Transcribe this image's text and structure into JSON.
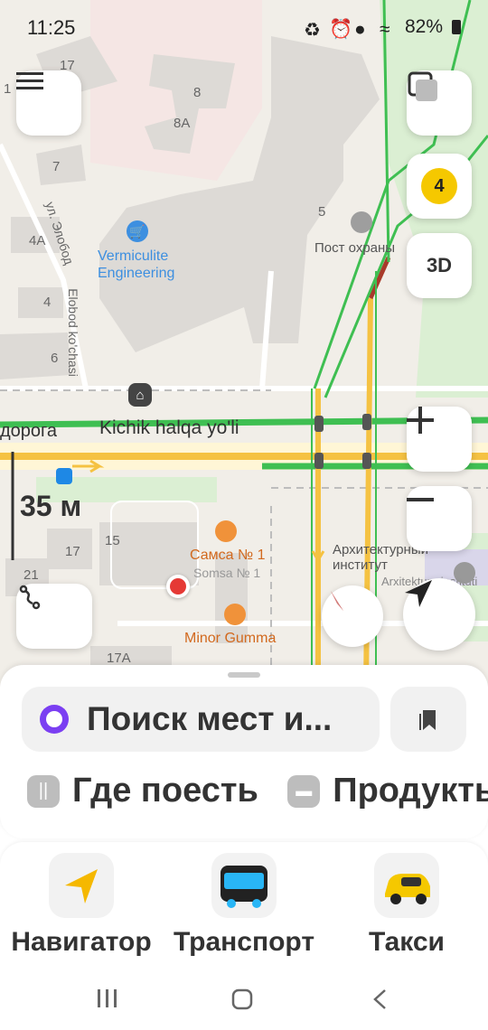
{
  "status_bar": {
    "time": "11:25",
    "battery": "82%"
  },
  "map": {
    "house_numbers": [
      "17",
      "8",
      "8A",
      "7",
      "4A",
      "4",
      "6",
      "5",
      "15",
      "17",
      "21",
      "17A",
      "1"
    ],
    "street_vertical": "ул. Элобод",
    "street_vertical_latin": "Elobod ko'chasi",
    "road_name_ru": "дорога",
    "road_name_uz": "Kichik halqa yo'li",
    "poi_vermiculite": "Vermiculite Engineering",
    "poi_guard_post": "Пост охраны",
    "poi_architecture_ru": "Архитектурный институт",
    "poi_architecture_latin": "Arxitektura instituti",
    "poi_samsa_ru": "Самса № 1",
    "poi_samsa_latin": "Somsa № 1",
    "poi_minor": "Minor Gumma",
    "scale_label": "35 м",
    "traffic_level": "4",
    "btn_3d": "3D",
    "colors": {
      "road_green": "#3fbf52",
      "road_yellow": "#f5c242",
      "road_red": "#a83a2a",
      "accent_blue": "#1e88e5"
    }
  },
  "search": {
    "placeholder": "Поиск мест и..."
  },
  "categories": [
    {
      "label": "Где поесть",
      "icon": "fork-knife-icon"
    },
    {
      "label": "Продукты",
      "icon": "basket-icon"
    }
  ],
  "apps": [
    {
      "label": "Навигатор",
      "icon": "navigator-arrow-icon"
    },
    {
      "label": "Транспорт",
      "icon": "bus-icon"
    },
    {
      "label": "Такси",
      "icon": "taxi-icon"
    }
  ]
}
